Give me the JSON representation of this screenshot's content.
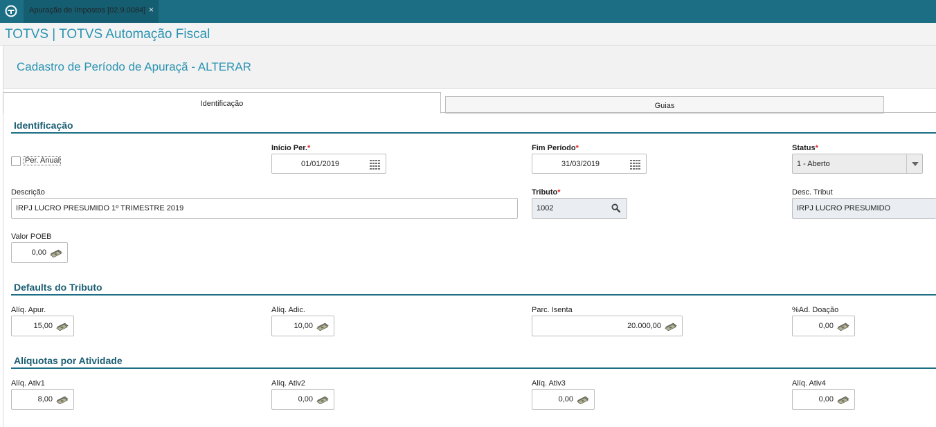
{
  "window_tab": {
    "label": "Apuração de Impostos [02.9.0084]",
    "close": "×"
  },
  "app_title": "TOTVS | TOTVS Automação Fiscal",
  "page_title": "Cadastro de Período de Apuraçã - ALTERAR",
  "tabs": [
    {
      "label": "Identificação",
      "active": true
    },
    {
      "label": "Guias",
      "active": false
    }
  ],
  "sections": {
    "identificacao": "Identificação",
    "defaults": "Defaults do Tributo",
    "aliquotas": "Alíquotas por Atividade"
  },
  "required_mark": "*",
  "identificacao": {
    "per_anual": {
      "label": "Per. Anual",
      "checked": false
    },
    "inicio_per": {
      "label": "Início Per.",
      "value": "01/01/2019",
      "required": true
    },
    "fim_periodo": {
      "label": "Fim Período",
      "value": "31/03/2019",
      "required": true
    },
    "status": {
      "label": "Status",
      "value": "1 - Aberto",
      "required": true
    },
    "descricao": {
      "label": "Descrição",
      "value": "IRPJ LUCRO PRESUMIDO 1º TRIMESTRE 2019"
    },
    "tributo": {
      "label": "Tributo",
      "value": "1002",
      "required": true
    },
    "desc_tribut": {
      "label": "Desc. Tribut",
      "value": "IRPJ LUCRO PRESUMIDO"
    },
    "valor_poeb": {
      "label": "Valor POEB",
      "value": "0,00"
    }
  },
  "defaults": {
    "aliq_apur": {
      "label": "Alíq. Apur.",
      "value": "15,00"
    },
    "aliq_adic": {
      "label": "Alíq. Adic.",
      "value": "10,00"
    },
    "parc_isenta": {
      "label": "Parc. Isenta",
      "value": "20.000,00"
    },
    "ad_doacao": {
      "label": "%Ad. Doação",
      "value": "0,00"
    }
  },
  "aliquotas": {
    "ativ1": {
      "label": "Alíq. Ativ1",
      "value": "8,00"
    },
    "ativ2": {
      "label": "Alíq. Ativ2",
      "value": "0,00"
    },
    "ativ3": {
      "label": "Alíq. Ativ3",
      "value": "0,00"
    },
    "ativ4": {
      "label": "Alíq. Ativ4",
      "value": "0,00"
    }
  },
  "icons": {
    "calendar": "calendar-icon",
    "search": "search-icon",
    "money": "money-icon",
    "dropdown": "chevron-down-icon"
  },
  "colors": {
    "topbar": "#1b6e84",
    "title": "#2a93b1",
    "section": "#1b5e73",
    "required": "#e02020"
  }
}
